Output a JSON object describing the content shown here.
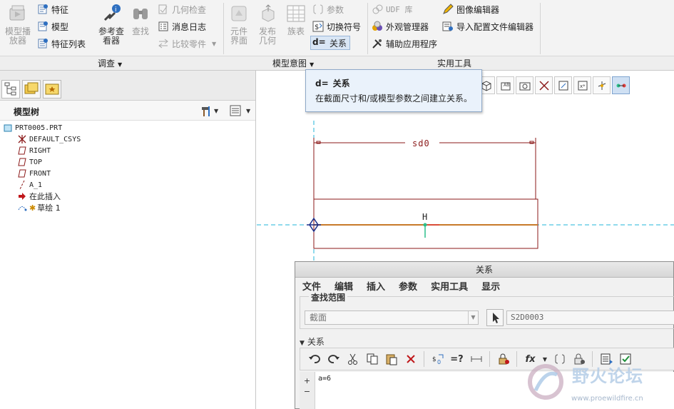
{
  "ribbon": {
    "groups": {
      "investigate": "调查",
      "model_intent": "模型意图",
      "utilities": "实用工具"
    },
    "buttons": {
      "model_player": "模型播\n放器",
      "feature": "特征",
      "model": "模型",
      "feature_list": "特征列表",
      "reference_viewer": "参考查\n看器",
      "find": "查找",
      "geometry_check": "几何检查",
      "message_log": "消息日志",
      "compare_parts": "比较零件",
      "component_interface": "元件\n界面",
      "publish_geometry": "发布\n几何",
      "family_table": "族表",
      "parameters": "参数",
      "switch_symbols": "切换符号",
      "relations": "关系",
      "udf_library": "UDF 库",
      "appearance_manager": "外观管理器",
      "auxiliary_apps": "辅助应用程序",
      "image_editor": "图像编辑器",
      "config_editor": "导入配置文件编辑器"
    }
  },
  "tooltip": {
    "title": "关系",
    "description": "在截面尺寸和/或模型参数之间建立关系。"
  },
  "model_tree": {
    "title": "模型树",
    "items": [
      {
        "label": "PRT0005.PRT",
        "icon": "part-icon"
      },
      {
        "label": "DEFAULT_CSYS",
        "icon": "csys-icon"
      },
      {
        "label": "RIGHT",
        "icon": "datum-plane-icon"
      },
      {
        "label": "TOP",
        "icon": "datum-plane-icon"
      },
      {
        "label": "FRONT",
        "icon": "datum-plane-icon"
      },
      {
        "label": "A_1",
        "icon": "datum-axis-icon"
      },
      {
        "label": "在此插入",
        "icon": "insert-here-arrow-icon"
      },
      {
        "label": "草绘 1",
        "icon": "sketch-icon"
      }
    ]
  },
  "canvas": {
    "dimension_label": "sd0",
    "constraint_label": "H"
  },
  "relations_dialog": {
    "title": "关系",
    "menu": [
      "文件",
      "编辑",
      "插入",
      "参数",
      "实用工具",
      "显示"
    ],
    "scope_label": "查找范围",
    "scope_value": "截面",
    "scope_entity": "S2D0003",
    "section_label": "关系",
    "relation_text": "a=6",
    "gutter_plus": "+",
    "gutter_minus": "−"
  },
  "watermark": {
    "title": "野火论坛",
    "url": "www.proewildfire.cn"
  },
  "colors": {
    "accent_blue": "#2e6fc0",
    "dimension_red": "#8b1a1a",
    "centerline_cyan": "#22b5d8",
    "tooltip_bg": "#eaf2fb"
  }
}
